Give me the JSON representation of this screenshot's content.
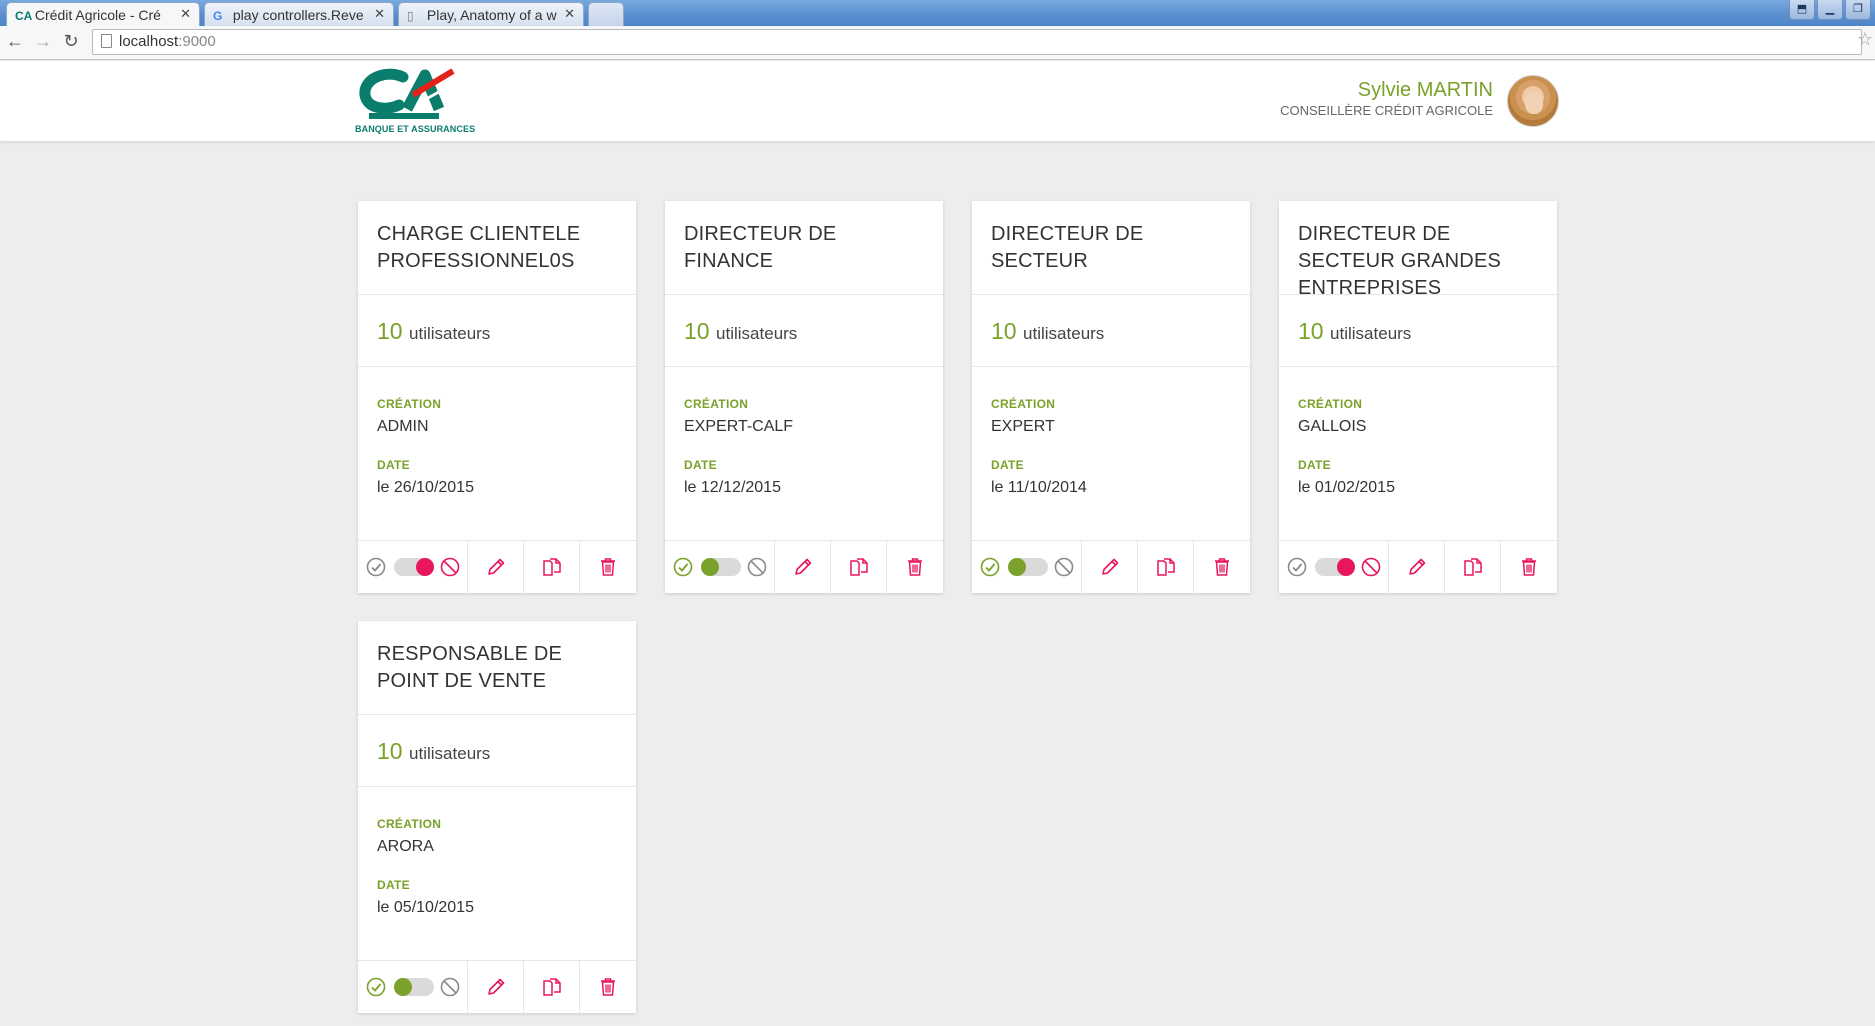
{
  "browser": {
    "tabs": [
      {
        "title": "Crédit Agricole - Cré",
        "active": true
      },
      {
        "title": "play controllers.Reve",
        "active": false
      },
      {
        "title": "Play, Anatomy of a w",
        "active": false
      }
    ],
    "url_host": "localhost",
    "url_port": ":9000"
  },
  "header": {
    "logo_tagline": "BANQUE ET ASSURANCES",
    "user_name": "Sylvie MARTIN",
    "user_role": "CONSEILLÈRE CRÉDIT AGRICOLE"
  },
  "labels": {
    "users": "utilisateurs",
    "creation": "CRÉATION",
    "date": "DATE"
  },
  "colors": {
    "green": "#7aa22a",
    "pink": "#e8175d",
    "brand_teal": "#0a7d6c",
    "brand_red": "#e2231a"
  },
  "icons": [
    "check-circle-icon",
    "ban-icon",
    "pencil-icon",
    "copy-icon",
    "trash-icon"
  ],
  "cards": [
    {
      "title": "CHARGE CLIENTELE PROFESSIONNEL0S",
      "users_count": "10",
      "creator": "ADMIN",
      "date": "le 26/10/2015",
      "active": false
    },
    {
      "title": "DIRECTEUR DE FINANCE",
      "users_count": "10",
      "creator": "EXPERT-CALF",
      "date": "le 12/12/2015",
      "active": true
    },
    {
      "title": "DIRECTEUR DE SECTEUR",
      "users_count": "10",
      "creator": "EXPERT",
      "date": "le 11/10/2014",
      "active": true
    },
    {
      "title": "DIRECTEUR DE SECTEUR GRANDES ENTREPRISES",
      "users_count": "10",
      "creator": "GALLOIS",
      "date": "le 01/02/2015",
      "active": false
    },
    {
      "title": "RESPONSABLE DE POINT DE VENTE",
      "users_count": "10",
      "creator": "ARORA",
      "date": "le 05/10/2015",
      "active": true
    }
  ]
}
